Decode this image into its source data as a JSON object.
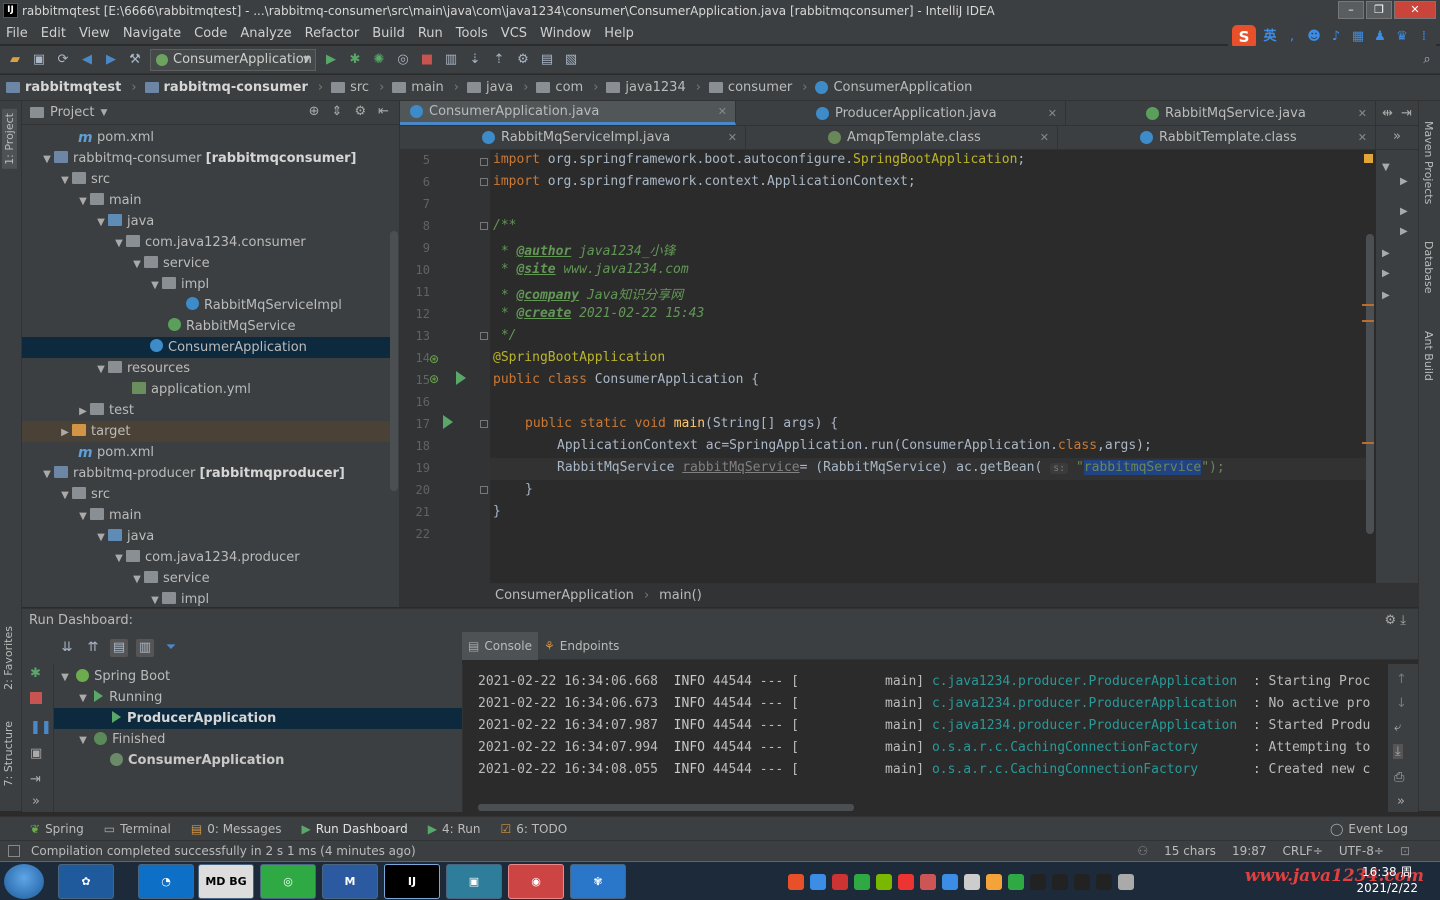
{
  "window": {
    "title": "rabbitmqtest [E:\\6666\\rabbitmqtest] - ...\\rabbitmq-consumer\\src\\main\\java\\com\\java1234\\consumer\\ConsumerApplication.java [rabbitmqconsumer] - IntelliJ IDEA",
    "app_icon": "IJ",
    "min": "–",
    "max": "❐",
    "close": "✕"
  },
  "menu": [
    "File",
    "Edit",
    "View",
    "Navigate",
    "Code",
    "Analyze",
    "Refactor",
    "Build",
    "Run",
    "Tools",
    "VCS",
    "Window",
    "Help"
  ],
  "ime": {
    "logo": "S",
    "lang": "英"
  },
  "toolbar": {
    "run_config": "ConsumerApplication"
  },
  "breadcrumb": [
    "rabbitmqtest",
    "rabbitmq-consumer",
    "src",
    "main",
    "java",
    "com",
    "java1234",
    "consumer",
    "ConsumerApplication"
  ],
  "left_stripe": {
    "project": "1: Project",
    "favorites": "2: Favorites",
    "structure": "7: Structure"
  },
  "right_stripe": {
    "maven": "Maven Projects",
    "database": "Database",
    "ant": "Ant Build"
  },
  "project_panel": {
    "title": "Project",
    "rows": [
      {
        "label": "pom.xml",
        "extra": ""
      },
      {
        "label": "rabbitmq-consumer",
        "extra": "[rabbitmqconsumer]"
      },
      {
        "label": "src",
        "extra": ""
      },
      {
        "label": "main",
        "extra": ""
      },
      {
        "label": "java",
        "extra": ""
      },
      {
        "label": "com.java1234.consumer",
        "extra": ""
      },
      {
        "label": "service",
        "extra": ""
      },
      {
        "label": "impl",
        "extra": ""
      },
      {
        "label": "RabbitMqServiceImpl",
        "extra": ""
      },
      {
        "label": "RabbitMqService",
        "extra": ""
      },
      {
        "label": "ConsumerApplication",
        "extra": ""
      },
      {
        "label": "resources",
        "extra": ""
      },
      {
        "label": "application.yml",
        "extra": ""
      },
      {
        "label": "test",
        "extra": ""
      },
      {
        "label": "target",
        "extra": ""
      },
      {
        "label": "pom.xml",
        "extra": ""
      },
      {
        "label": "rabbitmq-producer",
        "extra": "[rabbitmqproducer]"
      },
      {
        "label": "src",
        "extra": ""
      },
      {
        "label": "main",
        "extra": ""
      },
      {
        "label": "java",
        "extra": ""
      },
      {
        "label": "com.java1234.producer",
        "extra": ""
      },
      {
        "label": "service",
        "extra": ""
      },
      {
        "label": "impl",
        "extra": ""
      }
    ]
  },
  "editor_tabs_row1": [
    "ConsumerApplication.java",
    "ProducerApplication.java",
    "RabbitMqService.java"
  ],
  "editor_tabs_row2": [
    "RabbitMqServiceImpl.java",
    "AmqpTemplate.class",
    "RabbitTemplate.class"
  ],
  "code": {
    "line_numbers": [
      "5",
      "6",
      "7",
      "8",
      "9",
      "10",
      "11",
      "12",
      "13",
      "14",
      "15",
      "16",
      "17",
      "18",
      "19",
      "20",
      "21",
      "22"
    ],
    "import1_kw": "import",
    "import1_pkg": " org.springframework.boot.autoconfigure.",
    "import1_cls": "SpringBootApplication",
    "import1_end": ";",
    "import2_kw": "import",
    "import2_rest": " org.springframework.context.ApplicationContext;",
    "doc_open": "/**",
    "doc_star": " * ",
    "tag_author": "@author",
    "val_author": " java1234_小锋",
    "tag_site": "@site",
    "val_site": " www.java1234.com",
    "tag_company": "@company",
    "val_company": " Java知识分享网",
    "tag_create": "@create",
    "val_create": " 2021-02-22 15:43",
    "doc_close": " */",
    "annotation": "@SpringBootApplication",
    "kw_public_class": "public class",
    "class_decl": " ConsumerApplication {",
    "kw_main": "public static void",
    "fn_main": "main",
    "main_args": "(String[] args) {",
    "l18_a": "ApplicationContext ac=SpringApplication.run(ConsumerApplication.",
    "l18_kw": "class",
    "l18_b": ",args);",
    "l19_a": "RabbitMqService ",
    "l19_var": "rabbitMqService",
    "l19_b": "= (RabbitMqService) ac.getBean( ",
    "l19_hint": "s:",
    "l19_q1": " \"",
    "l19_str": "rabbitmqService",
    "l19_q2": "\");",
    "brace_close_inner": "}",
    "brace_close_outer": "}"
  },
  "editor_crumb": [
    "ConsumerApplication",
    "main()"
  ],
  "run_dashboard": {
    "title": "Run Dashboard:",
    "tree": {
      "root": "Spring Boot",
      "running": "Running",
      "running_app": "ProducerApplication",
      "finished": "Finished",
      "finished_app": "ConsumerApplication"
    }
  },
  "console_tabs": [
    "Console",
    "Endpoints"
  ],
  "console_lines": [
    {
      "ts": "2021-02-22 16:34:06.668",
      "lvl": "INFO",
      "pid": "44544 --- [",
      "thread": "main]",
      "logger": "c.java1234.producer.ProducerApplication ",
      "msg": " : Starting Proc"
    },
    {
      "ts": "2021-02-22 16:34:06.673",
      "lvl": "INFO",
      "pid": "44544 --- [",
      "thread": "main]",
      "logger": "c.java1234.producer.ProducerApplication ",
      "msg": " : No active pro"
    },
    {
      "ts": "2021-02-22 16:34:07.987",
      "lvl": "INFO",
      "pid": "44544 --- [",
      "thread": "main]",
      "logger": "c.java1234.producer.ProducerApplication ",
      "msg": " : Started Produ"
    },
    {
      "ts": "2021-02-22 16:34:07.994",
      "lvl": "INFO",
      "pid": "44544 --- [",
      "thread": "main]",
      "logger": "o.s.a.r.c.CachingConnectionFactory      ",
      "msg": " : Attempting to"
    },
    {
      "ts": "2021-02-22 16:34:08.055",
      "lvl": "INFO",
      "pid": "44544 --- [",
      "thread": "main]",
      "logger": "o.s.a.r.c.CachingConnectionFactory      ",
      "msg": " : Created new c"
    }
  ],
  "bottom_tabs": [
    "Spring",
    "Terminal",
    "0: Messages",
    "Run Dashboard",
    "4: Run",
    "6: TODO"
  ],
  "event_log": "Event Log",
  "status": {
    "message": "Compilation completed successfully in 2 s 1 ms (4 minutes ago)",
    "chars": "15 chars",
    "position": "19:87",
    "line_sep": "CRLF÷",
    "encoding": "UTF-8÷"
  },
  "taskbar": {
    "apps": [
      "MD BG",
      "IJ"
    ],
    "clock_time": "16:38 周",
    "clock_date": "2021/2/22",
    "watermark": "www.java1234.com"
  },
  "colors": {
    "accent": "#4a88c7",
    "selection": "#0d293e",
    "keyword": "#cc7832",
    "string": "#6a8759",
    "annotation": "#bbb529"
  }
}
